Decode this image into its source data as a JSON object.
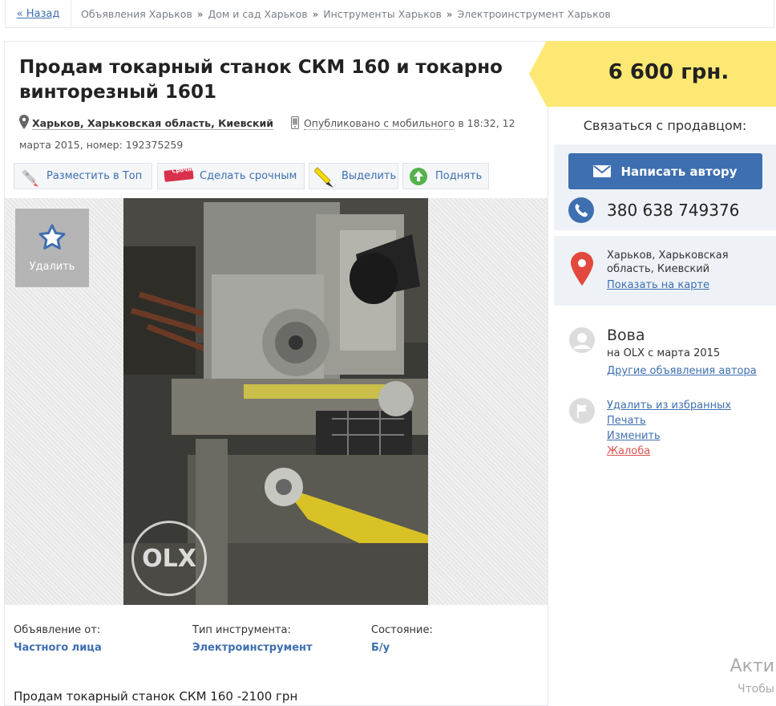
{
  "breadcrumb": {
    "back": "« Назад",
    "items": [
      "Объявления Харьков",
      "Дом и сад Харьков",
      "Инструменты Харьков",
      "Электроинструмент Харьков"
    ],
    "separator": "»"
  },
  "ad": {
    "title": "Продам токарный станок СКМ 160 и токарно винторезный 1601",
    "location": "Харьков, Харьковская область, Киевский",
    "published_link": "Опубликовано с мобильного",
    "published_rest": " в 18:32, 12 марта 2015, номер: 192375259"
  },
  "promo": {
    "top": "Разместить в Топ",
    "urgent": "Сделать срочным",
    "urgent_sticker": "Срочно",
    "highlight": "Выделить",
    "raise": "Поднять"
  },
  "gallery": {
    "fav_label": "Удалить",
    "watermark": "OLX"
  },
  "details": [
    {
      "label": "Объявление от:",
      "value": "Частного лица"
    },
    {
      "label": "Тип инструмента:",
      "value": "Электроинструмент"
    },
    {
      "label": "Состояние:",
      "value": "Б/у"
    }
  ],
  "description": "Продам токарный станок СКМ 160 -2100 грн",
  "price": "6 600 грн.",
  "contact": {
    "title": "Связаться с продавцом:",
    "write_button": "Написать автору",
    "phone": "380 638 749376"
  },
  "map": {
    "address": "Харьков, Харьковская область, Киевский",
    "show_map": "Показать на карте"
  },
  "seller": {
    "name": "Вова",
    "since": "на OLX с марта 2015",
    "other_ads": "Другие объявления автора"
  },
  "actions": {
    "remove_fav": "Удалить из избранных",
    "print": "Печать",
    "edit": "Изменить",
    "report": "Жалоба"
  },
  "windows_watermark": {
    "line1": "Акти",
    "line2": "Чтобы"
  },
  "colors": {
    "link": "#3e6fb0",
    "price_bg": "#fde873",
    "button": "#3e6fb0",
    "report": "#d9534f"
  }
}
